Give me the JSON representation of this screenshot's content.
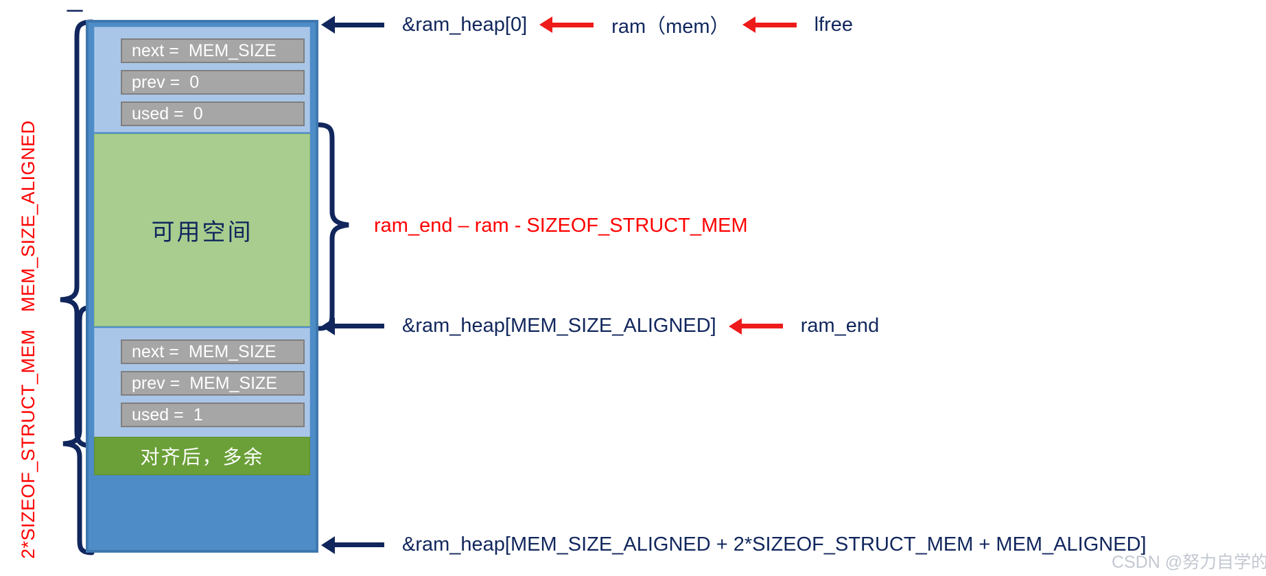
{
  "diagram": {
    "title_fragment": "_",
    "watermark": "CSDN @努力自学的小夏",
    "colors": {
      "block_fill": "#4e8cc8",
      "struct_region": "#a9c6e8",
      "free_region": "#a8cd8f",
      "surplus_region": "#6ba038",
      "field_fill": "#a6a6a6",
      "navy_text": "#10265c",
      "red_text": "#ff0000",
      "red_arrow": "#ee1b1b"
    }
  },
  "vertical_labels": [
    {
      "name": "mem-size-aligned",
      "text": "MEM_SIZE_ALIGNED"
    },
    {
      "name": "sizeof-struct-mem",
      "text": "2*SIZEOF_STRUCT_MEM"
    }
  ],
  "block": {
    "top_struct": {
      "fields": [
        {
          "name": "next",
          "label": "next =",
          "value": "MEM_SIZE"
        },
        {
          "name": "prev",
          "label": "prev =",
          "value": "0"
        },
        {
          "name": "used",
          "label": "used =",
          "value": "0"
        }
      ]
    },
    "free_region": {
      "label": "可用空间"
    },
    "bottom_struct": {
      "fields": [
        {
          "name": "next",
          "label": "next =",
          "value": "MEM_SIZE"
        },
        {
          "name": "prev",
          "label": "prev =",
          "value": "MEM_SIZE"
        },
        {
          "name": "used",
          "label": "used =",
          "value": "1"
        }
      ]
    },
    "surplus_region": {
      "label": "对齐后，多余"
    }
  },
  "annotations": {
    "top": {
      "primary": "&ram_heap[0]",
      "second": "ram（mem）",
      "third": "lfree"
    },
    "middle_size": "ram_end – ram - SIZEOF_STRUCT_MEM",
    "ram_end": {
      "primary": "&ram_heap[MEM_SIZE_ALIGNED]",
      "second": "ram_end"
    },
    "bottom": {
      "primary": "&ram_heap[MEM_SIZE_ALIGNED + 2*SIZEOF_STRUCT_MEM + MEM_ALIGNED]"
    }
  }
}
